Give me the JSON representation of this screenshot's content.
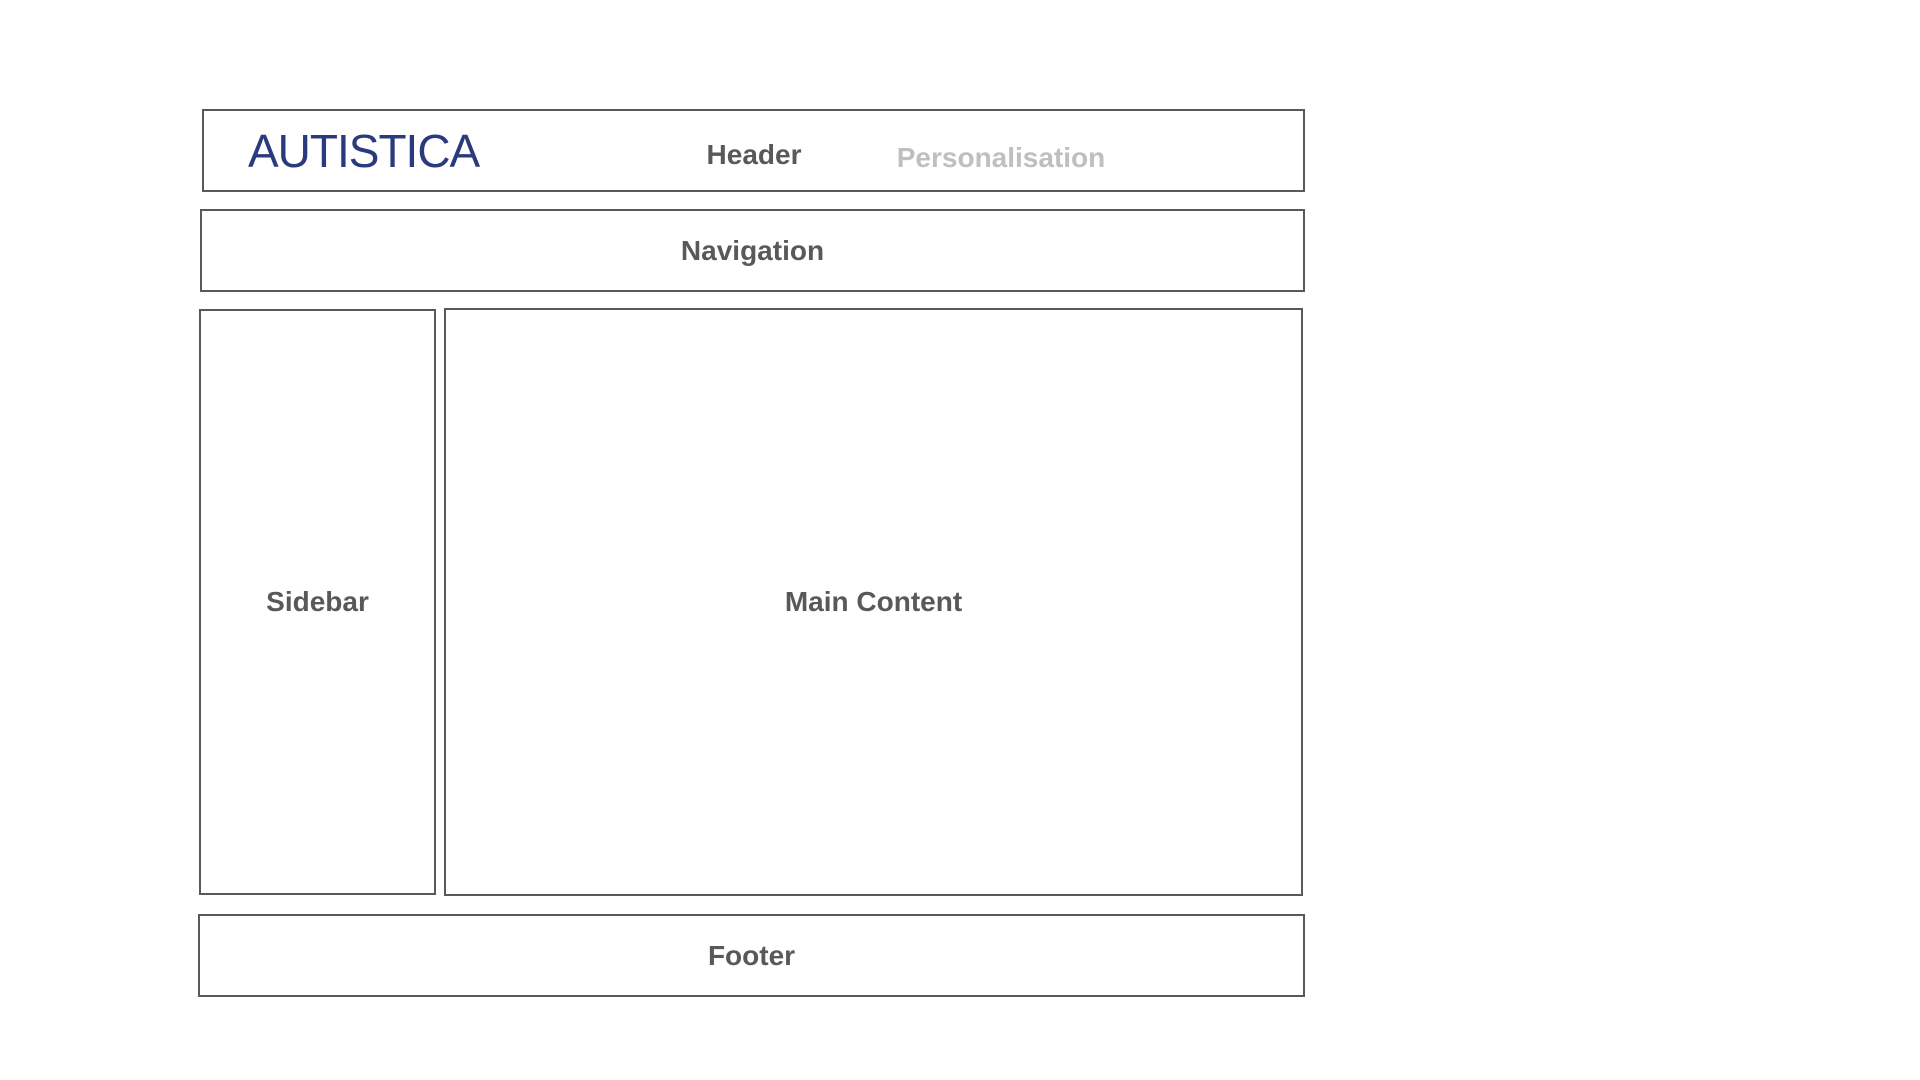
{
  "header": {
    "logo_text": "AUTISTICA",
    "label": "Header",
    "personalisation_label": "Personalisation"
  },
  "navigation": {
    "label": "Navigation"
  },
  "sidebar": {
    "label": "Sidebar"
  },
  "main": {
    "label": "Main Content"
  },
  "footer": {
    "label": "Footer"
  },
  "colors": {
    "border": "#595959",
    "text": "#595959",
    "muted_text": "#bfbfbf",
    "logo": "#2b3a7d",
    "background": "#ffffff"
  }
}
